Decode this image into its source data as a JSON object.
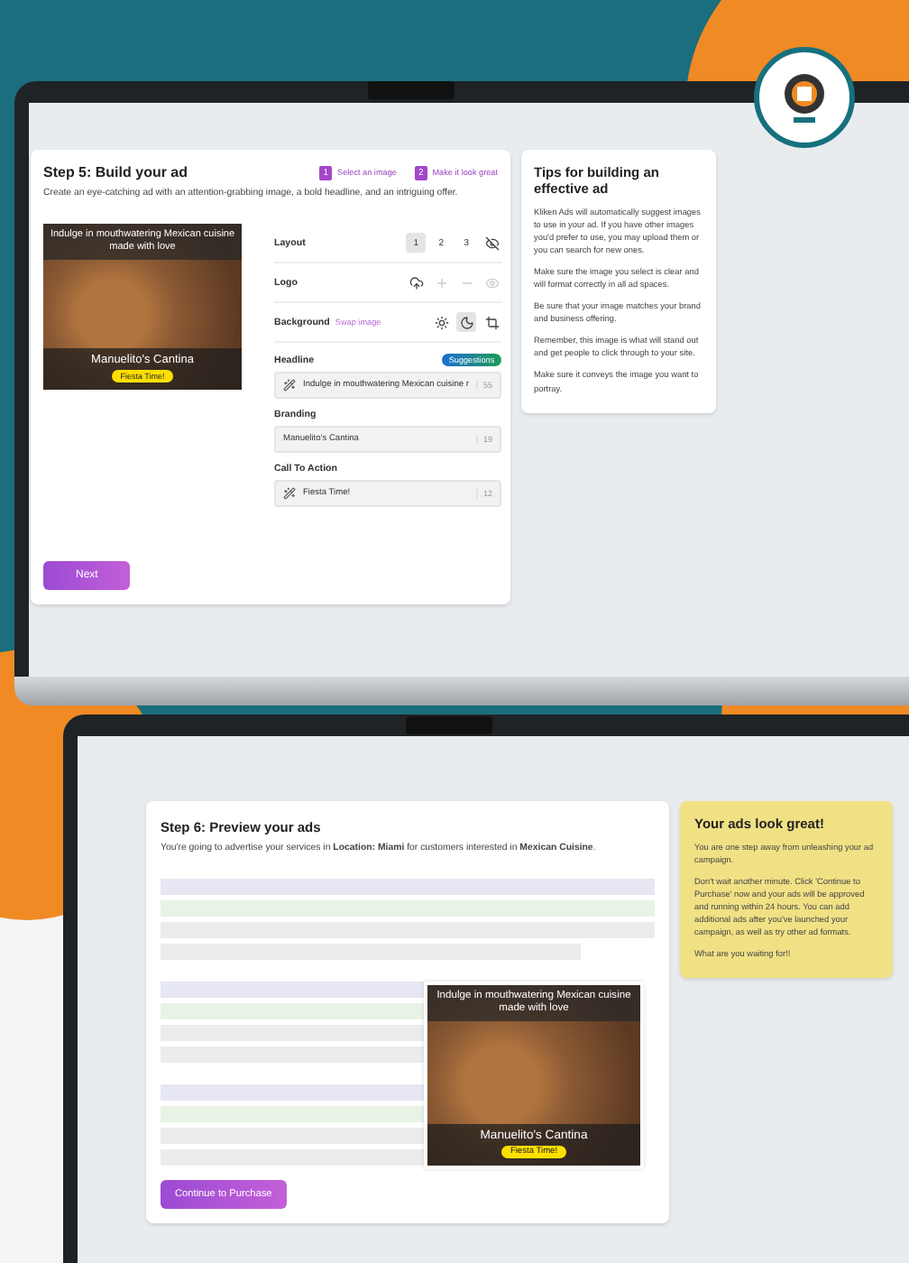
{
  "build_step": {
    "title": "Step 5: Build your ad",
    "subtitle": "Create an eye-catching ad with an attention-grabbing image, a bold headline, and an intriguing offer.",
    "steps": [
      {
        "number": "1",
        "label": "Select an image"
      },
      {
        "number": "2",
        "label": "Make it look great"
      }
    ],
    "ad": {
      "headline": "Indulge in mouthwatering Mexican cuisine made with love",
      "branding": "Manuelito's Cantina",
      "call_to_action": "Fiesta Time!"
    },
    "layout": {
      "label": "Layout",
      "options": [
        {
          "label": "1",
          "selected": true
        },
        {
          "label": "2",
          "selected": false
        },
        {
          "label": "3",
          "selected": false
        }
      ]
    },
    "logo": {
      "label": "Logo"
    },
    "background": {
      "label": "Background",
      "link": "Swap image",
      "modes": [
        {
          "kind": "light",
          "selected": false
        },
        {
          "kind": "dark",
          "selected": true
        }
      ]
    },
    "fields": [
      {
        "label": "Headline",
        "value": "Indulge in mouthwatering Mexican cuisine r",
        "count": "55",
        "magic": true,
        "suggestions": "Suggestions"
      },
      {
        "label": "Branding",
        "value": "Manuelito's Cantina",
        "count": "19",
        "magic": false
      },
      {
        "label": "Call To Action",
        "value": "Fiesta Time!",
        "count": "12",
        "magic": true
      }
    ],
    "next_button": "Next"
  },
  "tips": {
    "title": "Tips for building an effective ad",
    "paragraphs": [
      "Kliken Ads will automatically suggest images to use in your ad. If you have other images you'd prefer to use, you may upload them or you can search for new ones.",
      "Make sure the image you select is clear and will format correctly in all ad spaces.",
      "Be sure that your image matches your brand and business offering.",
      "Remember, this image is what will stand out and get people to click through to your site.",
      "Make sure it conveys the image you want to portray."
    ]
  },
  "preview_step": {
    "title": "Step 6: Preview your ads",
    "description": "You're going to advertise your services in **Location: Miami** for customers interested in **Mexican Cuisine**.",
    "ad": {
      "headline": "Indulge in mouthwatering Mexican cuisine made with love",
      "branding": "Manuelito's Cantina",
      "call_to_action": "Fiesta Time!"
    },
    "button": "Continue to Purchase"
  },
  "great": {
    "title": "Your ads look great!",
    "paragraphs": [
      "You are one step away from unleashing your ad campaign.",
      "Don't wait another minute. Click 'Continue to Purchase' now and your ads will be approved and running within 24 hours. You can add additional ads after you've launched your campaign, as well as try other ad formats.",
      "What are you waiting for!!"
    ]
  }
}
